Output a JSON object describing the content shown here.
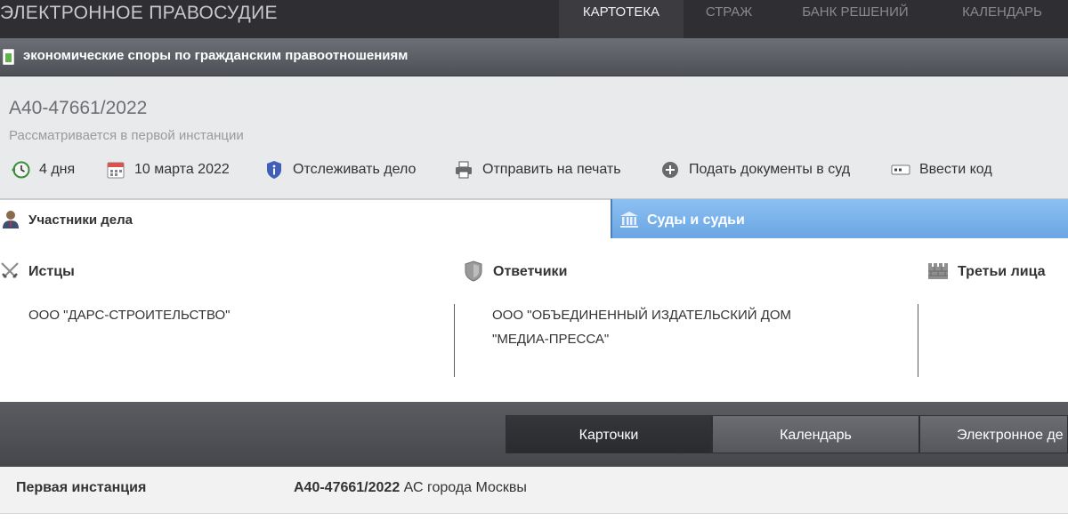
{
  "header": {
    "brand": "ЭЛЕКТРОННОЕ ПРАВОСУДИЕ",
    "nav": [
      {
        "label": "КАРТОТЕКА",
        "active": true
      },
      {
        "label": "СТРАЖ",
        "active": false
      },
      {
        "label": "БАНК РЕШЕНИЙ",
        "active": false
      },
      {
        "label": "КАЛЕНДАРЬ",
        "active": false
      }
    ]
  },
  "category": {
    "title": "экономические споры по гражданским правоотношениям",
    "icon": "document-icon"
  },
  "case": {
    "number": "А40-47661/2022",
    "status": "Рассматривается в первой инстанции",
    "toolbar": [
      {
        "label": "4 дня",
        "icon": "clock-back-icon"
      },
      {
        "label": "10 марта 2022",
        "icon": "calendar-icon"
      },
      {
        "label": "Отслеживать дело",
        "icon": "shield-info-icon"
      },
      {
        "label": "Отправить на печать",
        "icon": "printer-icon"
      },
      {
        "label": "Подать документы в суд",
        "icon": "plus-circle-icon"
      },
      {
        "label": "Ввести код",
        "icon": "code-card-icon"
      }
    ]
  },
  "tabs": {
    "participants": "Участники дела",
    "courts": "Суды и судьи"
  },
  "parties": {
    "plaintiffs": {
      "title": "Истцы",
      "items": [
        "ООО \"ДАРС-СТРОИТЕЛЬСТВО\""
      ]
    },
    "defendants": {
      "title": "Ответчики",
      "items": [
        "ООО \"ОБЪЕДИНЕННЫЙ ИЗДАТЕЛЬСКИЙ ДОМ",
        "\"МЕДИА-ПРЕССА\""
      ]
    },
    "third": {
      "title": "Третьи лица",
      "items": []
    }
  },
  "bottom": {
    "buttons": [
      {
        "label": "Карточки",
        "active": true
      },
      {
        "label": "Календарь",
        "active": false
      },
      {
        "label": "Электронное де",
        "active": false
      }
    ]
  },
  "instance": {
    "label": "Первая инстанция",
    "number": "А40-47661/2022",
    "court": " АС города Москвы"
  },
  "colors": {
    "topbar": "#2f2f33",
    "accent_tab": "#7bb3ec",
    "text": "#333333"
  }
}
